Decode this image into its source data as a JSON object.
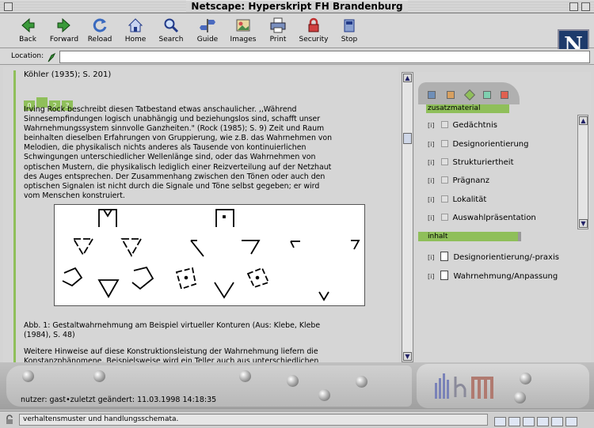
{
  "window": {
    "title": "Netscape: Hyperskript FH Brandenburg"
  },
  "toolbar": {
    "buttons": [
      {
        "label": "Back",
        "icon": "back-arrow-icon"
      },
      {
        "label": "Forward",
        "icon": "forward-arrow-icon"
      },
      {
        "label": "Reload",
        "icon": "reload-icon"
      },
      {
        "label": "Home",
        "icon": "home-icon"
      },
      {
        "label": "Search",
        "icon": "search-icon"
      },
      {
        "label": "Guide",
        "icon": "guide-icon"
      },
      {
        "label": "Images",
        "icon": "images-icon"
      },
      {
        "label": "Print",
        "icon": "print-icon"
      },
      {
        "label": "Security",
        "icon": "security-lock-icon"
      },
      {
        "label": "Stop",
        "icon": "stop-icon"
      }
    ],
    "logo_letter": "N"
  },
  "location": {
    "label": "Location:",
    "value": ""
  },
  "content": {
    "cite_line": "Köhler (1935); S. 201)",
    "nav_boxes": [
      "0",
      "",
      "2",
      "3"
    ],
    "paragraph1": "Irving Rock beschreibt diesen Tatbestand etwas anschaulicher. ,,Während\nSinnesempfindungen logisch unabhängig und beziehungslos sind, schafft unser\nWahrnehmungssystem sinnvolle Ganzheiten.\" (Rock (1985); S. 9) Zeit und Raum\nbeinhalten dieselben Erfahrungen von Gruppierung, wie z.B. das Wahrnehmen von\nMelodien, die physikalisch nichts anderes als Tausende von kontinuierlichen\nSchwingungen unterschiedlicher Wellenlänge sind, oder das Wahrnehmen von\noptischen Mustern, die physikalisch lediglich einer Reizverteilung auf der Netzhaut\ndes Auges entsprechen. Der Zusammenhang zwischen den Tönen oder auch den\noptischen Signalen ist nicht durch die Signale und Töne selbst gegeben; er wird\nvom Menschen konstruiert.",
    "caption": "Abb. 1: Gestaltwahrnehmung am Beispiel virtueller Konturen (Aus: Klebe, Klebe\n(1984), S. 48)",
    "paragraph2": "Weitere Hinweise auf diese Konstruktionsleistung der Wahrnehmung liefern die\nKonstanzphänomene. Beispielsweise wird ein Teller auch aus unterschiedlichen"
  },
  "right_panel": {
    "tab_colors": [
      "#6f8fb8",
      "#d8a060",
      "#8fbf5a",
      "#7fd0b0",
      "#e06050"
    ],
    "zusatz_label": "zusatzmaterial",
    "zusatz_items": [
      {
        "marker": "[i]",
        "label": "Gedächtnis"
      },
      {
        "marker": "[i]",
        "label": "Designorientierung"
      },
      {
        "marker": "[i]",
        "label": "Strukturiertheit"
      },
      {
        "marker": "[i]",
        "label": "Prägnanz"
      },
      {
        "marker": "[i]",
        "label": "Lokalität"
      },
      {
        "marker": "[i]",
        "label": "Auswahlpräsentation"
      }
    ],
    "inhalt_label": "inhalt",
    "inhalt_items": [
      {
        "marker": "[i]",
        "label": "Designorientierung/-praxis"
      },
      {
        "marker": "[i]",
        "label": "Wahrnehmung/Anpassung"
      }
    ]
  },
  "footer": {
    "user_info": "nutzer: gast•zuletzt geändert: 11.03.1998 14:18:35"
  },
  "status": {
    "text": "verhaltensmuster und handlungsschemata."
  }
}
